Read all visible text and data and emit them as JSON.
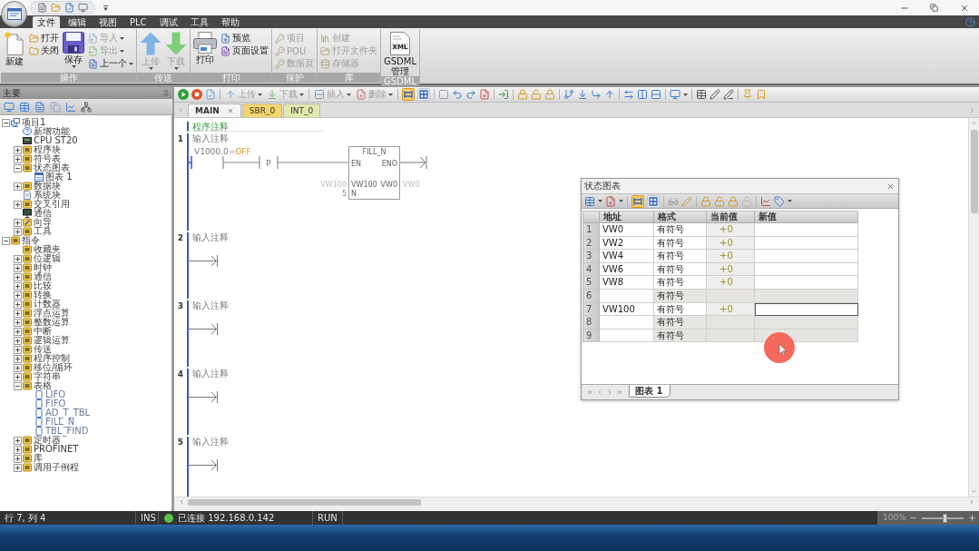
{
  "menu_tabs": [
    {
      "label": "文件",
      "selected": true
    },
    {
      "label": "编辑",
      "selected": false
    },
    {
      "label": "视图",
      "selected": false
    },
    {
      "label": "PLC",
      "selected": false
    },
    {
      "label": "调试",
      "selected": false
    },
    {
      "label": "工具",
      "selected": false
    },
    {
      "label": "帮助",
      "selected": false
    }
  ],
  "ribbon": {
    "groups": [
      {
        "label": "操作",
        "items": [
          {
            "label": "新建",
            "kind": "large",
            "disabled": false,
            "dropdown": false
          },
          {
            "label": "打开",
            "kind": "small",
            "disabled": false,
            "dropdown": false
          },
          {
            "label": "关闭",
            "kind": "small",
            "disabled": false,
            "dropdown": false
          },
          {
            "label": "保存",
            "kind": "large",
            "disabled": false,
            "dropdown": true
          },
          {
            "label": "导入",
            "kind": "small",
            "disabled": true,
            "dropdown": true
          },
          {
            "label": "导出",
            "kind": "small",
            "disabled": true,
            "dropdown": true
          },
          {
            "label": "上一个",
            "kind": "small",
            "disabled": false,
            "dropdown": true
          }
        ]
      },
      {
        "label": "传送",
        "items": [
          {
            "label": "上传",
            "kind": "large",
            "disabled": true,
            "dropdown": true
          },
          {
            "label": "下载",
            "kind": "large",
            "disabled": true,
            "dropdown": true
          }
        ]
      },
      {
        "label": "打印",
        "items": [
          {
            "label": "打印",
            "kind": "large",
            "disabled": false,
            "dropdown": false
          },
          {
            "label": "预览",
            "kind": "small",
            "disabled": false,
            "dropdown": false
          },
          {
            "label": "页面设置",
            "kind": "small",
            "disabled": false,
            "dropdown": false
          }
        ]
      },
      {
        "label": "保护",
        "items": [
          {
            "label": "项目",
            "kind": "small",
            "disabled": true,
            "dropdown": false
          },
          {
            "label": "POU",
            "kind": "small",
            "disabled": true,
            "dropdown": false
          },
          {
            "label": "数据页",
            "kind": "small",
            "disabled": true,
            "dropdown": false
          }
        ]
      },
      {
        "label": "库",
        "items": [
          {
            "label": "创建",
            "kind": "small",
            "disabled": true,
            "dropdown": false
          },
          {
            "label": "打开文件夹",
            "kind": "small",
            "disabled": true,
            "dropdown": false
          },
          {
            "label": "存储器",
            "kind": "small",
            "disabled": true,
            "dropdown": false
          }
        ]
      },
      {
        "label": "GSDML",
        "items": [
          {
            "label": "GSDML\n管理",
            "kind": "large",
            "disabled": false,
            "dropdown": false,
            "icon_label": "XML"
          }
        ]
      }
    ]
  },
  "project_panel": {
    "title": "主要",
    "tree": [
      {
        "label": "项目1",
        "kind": "project",
        "expanded": true,
        "children": [
          {
            "label": "新增功能",
            "kind": "info"
          },
          {
            "label": "CPU ST20",
            "kind": "cpu"
          },
          {
            "label": "程序块",
            "kind": "folder",
            "expanded": false
          },
          {
            "label": "符号表",
            "kind": "folder",
            "expanded": false
          },
          {
            "label": "状态图表",
            "kind": "folder",
            "expanded": true,
            "children": [
              {
                "label": "图表 1",
                "kind": "chart"
              }
            ]
          },
          {
            "label": "数据块",
            "kind": "folder",
            "expanded": false
          },
          {
            "label": "系统块",
            "kind": "block"
          },
          {
            "label": "交叉引用",
            "kind": "folder",
            "expanded": false
          },
          {
            "label": "通信",
            "kind": "comm"
          },
          {
            "label": "向导",
            "kind": "wizard",
            "expanded": false
          },
          {
            "label": "工具",
            "kind": "folder",
            "expanded": false
          }
        ]
      },
      {
        "label": "指令",
        "kind": "folder",
        "expanded": true,
        "children": [
          {
            "label": "收藏夹",
            "kind": "folder"
          },
          {
            "label": "位逻辑",
            "kind": "folder",
            "expanded": false
          },
          {
            "label": "时钟",
            "kind": "folder",
            "expanded": false
          },
          {
            "label": "通信",
            "kind": "folder",
            "expanded": false
          },
          {
            "label": "比较",
            "kind": "folder",
            "expanded": false
          },
          {
            "label": "转换",
            "kind": "folder",
            "expanded": false
          },
          {
            "label": "计数器",
            "kind": "folder",
            "expanded": false
          },
          {
            "label": "浮点运算",
            "kind": "folder",
            "expanded": false
          },
          {
            "label": "整数运算",
            "kind": "folder",
            "expanded": false
          },
          {
            "label": "中断",
            "kind": "folder",
            "expanded": false
          },
          {
            "label": "逻辑运算",
            "kind": "folder",
            "expanded": false
          },
          {
            "label": "传送",
            "kind": "folder",
            "expanded": false
          },
          {
            "label": "程序控制",
            "kind": "folder",
            "expanded": false
          },
          {
            "label": "移位/循环",
            "kind": "folder",
            "expanded": false
          },
          {
            "label": "字符串",
            "kind": "folder",
            "expanded": false
          },
          {
            "label": "表格",
            "kind": "folder",
            "expanded": true,
            "children": [
              {
                "label": "LIFO",
                "kind": "instruction"
              },
              {
                "label": "FIFO",
                "kind": "instruction"
              },
              {
                "label": "AD_T_TBL",
                "kind": "instruction"
              },
              {
                "label": "FILL_N",
                "kind": "instruction"
              },
              {
                "label": "TBL_FIND",
                "kind": "instruction"
              }
            ]
          },
          {
            "label": "定时器",
            "kind": "folder",
            "expanded": false
          },
          {
            "label": "PROFINET",
            "kind": "folder",
            "expanded": false
          },
          {
            "label": "库",
            "kind": "folder",
            "expanded": false
          },
          {
            "label": "调用子例程",
            "kind": "folder",
            "expanded": false
          }
        ]
      }
    ]
  },
  "editor": {
    "toolbar": {
      "buttons": [
        {
          "label": "上传",
          "disabled": true,
          "dropdown": true
        },
        {
          "label": "下载",
          "disabled": true,
          "dropdown": true
        },
        {
          "label": "插入",
          "disabled": true,
          "dropdown": true
        },
        {
          "label": "删除",
          "disabled": true,
          "dropdown": true
        }
      ],
      "monitor_toggles": [
        {
          "on": true
        },
        {
          "on": false
        }
      ]
    },
    "tabs": [
      {
        "label": "MAIN",
        "selected": true,
        "closable": true,
        "color": "#f4f4f4"
      },
      {
        "label": "SBR_0",
        "selected": false,
        "closable": false,
        "color": "#f2d76e"
      },
      {
        "label": "INT_0",
        "selected": false,
        "closable": false,
        "color": "#e2e8ae"
      }
    ],
    "program_comment": "程序注释",
    "networks": [
      {
        "number": "1",
        "comment": "输入注释",
        "kind": "box",
        "rung": {
          "contact_address": "V1000.0=",
          "contact_value": "OFF",
          "edge_label": "P",
          "block": {
            "title": "FILL_N",
            "enable_in": "EN",
            "enable_out": "ENO",
            "inputs": [
              {
                "pin": "VW100",
                "operand": "VW100"
              },
              {
                "pin": "N",
                "operand": "5"
              }
            ],
            "outputs": [
              {
                "pin": "VW0",
                "operand": "VW0"
              }
            ]
          }
        }
      },
      {
        "number": "2",
        "comment": "输入注释",
        "kind": "empty"
      },
      {
        "number": "3",
        "comment": "输入注释",
        "kind": "empty"
      },
      {
        "number": "4",
        "comment": "输入注释",
        "kind": "empty"
      },
      {
        "number": "5",
        "comment": "输入注释",
        "kind": "empty"
      }
    ]
  },
  "status_chart": {
    "title": "状态图表",
    "toolbar_toggles": [
      {
        "on": true
      },
      {
        "on": false
      }
    ],
    "columns": [
      "地址",
      "格式",
      "当前值",
      "新值"
    ],
    "rows": [
      {
        "number": "1",
        "address": "VW0",
        "format": "有符号",
        "current_value": "+0",
        "disabled": false,
        "selected": false
      },
      {
        "number": "2",
        "address": "VW2",
        "format": "有符号",
        "current_value": "+0",
        "disabled": false,
        "selected": false
      },
      {
        "number": "3",
        "address": "VW4",
        "format": "有符号",
        "current_value": "+0",
        "disabled": false,
        "selected": false
      },
      {
        "number": "4",
        "address": "VW6",
        "format": "有符号",
        "current_value": "+0",
        "disabled": false,
        "selected": false
      },
      {
        "number": "5",
        "address": "VW8",
        "format": "有符号",
        "current_value": "+0",
        "disabled": false,
        "selected": false
      },
      {
        "number": "6",
        "format": "有符号",
        "disabled": true,
        "selected": false
      },
      {
        "number": "7",
        "address": "VW100",
        "format": "有符号",
        "current_value": "+0",
        "disabled": false,
        "selected": true
      },
      {
        "number": "8",
        "format": "有符号",
        "disabled": true,
        "selected": false
      },
      {
        "number": "9",
        "format": "有符号",
        "disabled": true,
        "selected": false
      }
    ],
    "sheet_tabs": [
      {
        "label": "图表 1",
        "selected": true
      }
    ]
  },
  "status_bar": {
    "position": "行 7, 列 4",
    "mode": "INS",
    "connection": {
      "connected": true,
      "text": "已连接 192.168.0.142"
    },
    "plc_state": "RUN",
    "zoom": {
      "reading": "100%",
      "level": 0.55
    }
  }
}
